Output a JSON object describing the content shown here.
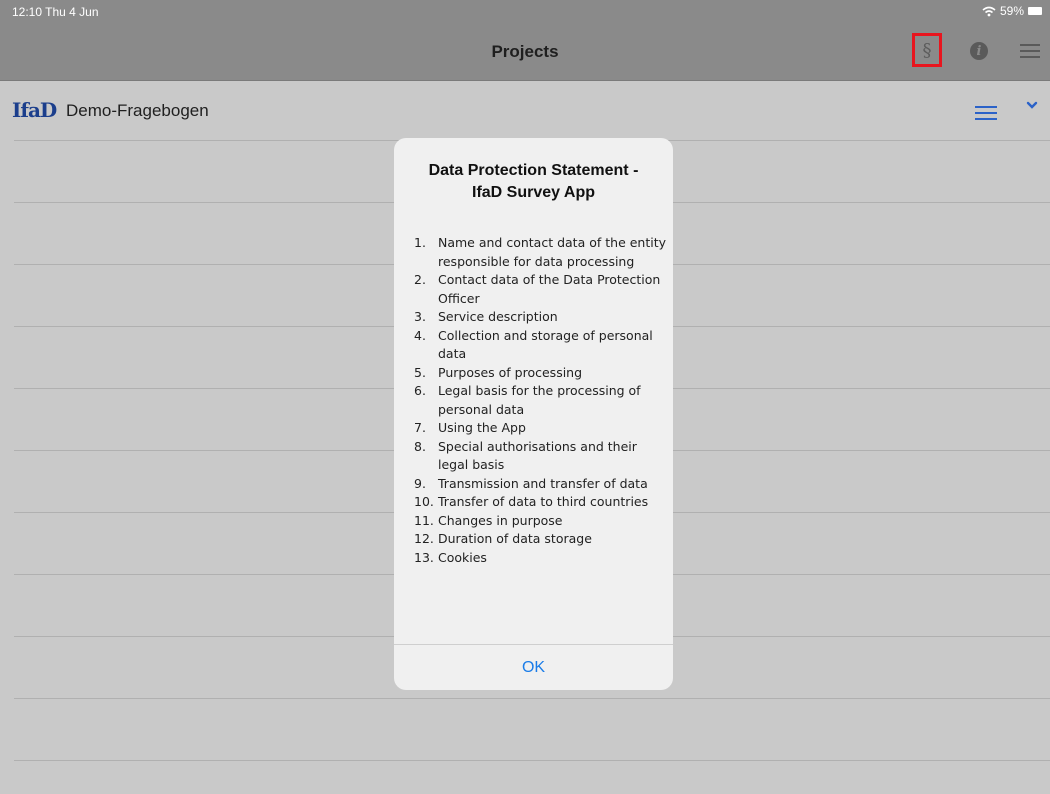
{
  "status": {
    "time": "12:10  Thu 4 Jun",
    "battery": "59%"
  },
  "nav": {
    "title": "Projects",
    "section_label": "§",
    "info_label": "i"
  },
  "project": {
    "logo": "IfaD",
    "name": "Demo-Fragebogen"
  },
  "dialog": {
    "title_line1": "Data Protection Statement -",
    "title_line2": "IfaD Survey App",
    "items": [
      {
        "num": "1.",
        "text": "Name and contact data of the entity responsible for data processing"
      },
      {
        "num": "2.",
        "text": "Contact data of the Data Protection Officer"
      },
      {
        "num": "3.",
        "text": "Service description"
      },
      {
        "num": "4.",
        "text": "Collection and storage of personal data"
      },
      {
        "num": "5.",
        "text": "Purposes of processing"
      },
      {
        "num": "6.",
        "text": "Legal basis for the processing of personal data"
      },
      {
        "num": "7.",
        "text": "Using the App"
      },
      {
        "num": "8.",
        "text": "Special authorisations and their legal basis"
      },
      {
        "num": "9.",
        "text": "Transmission and transfer of data"
      },
      {
        "num": "10.",
        "text": "Transfer of data to third countries"
      },
      {
        "num": "11.",
        "text": "Changes in purpose"
      },
      {
        "num": "12.",
        "text": "Duration of data storage"
      },
      {
        "num": "13.",
        "text": "Cookies"
      }
    ],
    "ok_label": "OK"
  },
  "colors": {
    "accent": "#1a7ce8",
    "highlight": "#e8151e",
    "logo": "#1b3e8c"
  }
}
